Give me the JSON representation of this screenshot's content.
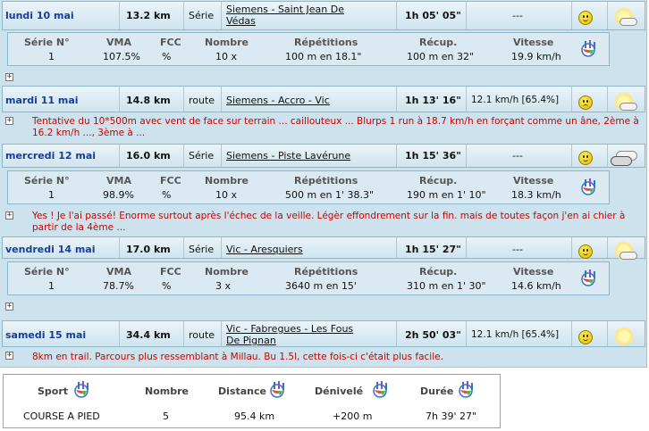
{
  "days": [
    {
      "date": "lundi 10 mai",
      "distance": "13.2 km",
      "type": "Série",
      "place": "Siemens - Saint Jean De Védas",
      "duration": "1h 05' 05\"",
      "speed": "",
      "speed_placeholder": "---",
      "mood": "happy",
      "weather": "sun-cloud",
      "comment": "",
      "detail": {
        "headers": [
          "Série N°",
          "VMA",
          "FCC",
          "Nombre",
          "Répétitions",
          "Récup.",
          "Vitesse"
        ],
        "values": [
          "1",
          "107.5%",
          "%",
          "10 x",
          "100 m en 18.1\"",
          "100 m en 32\"",
          "19.9 km/h"
        ]
      }
    },
    {
      "date": "mardi 11 mai",
      "distance": "14.8 km",
      "type": "route",
      "place": "Siemens - Accro - Vic",
      "duration": "1h 13' 16\"",
      "speed": "12.1 km/h [65.4%]",
      "speed_placeholder": "",
      "mood": "sad",
      "weather": "sun-cloud",
      "comment": "Tentative du 10*500m avec vent de face sur terrain ... caillouteux ... Blurps 1 run à 18.7 km/h en forçant comme un âne, 2ème à 16.2 km/h ..., 3ème à ...",
      "detail": null
    },
    {
      "date": "mercredi 12 mai",
      "distance": "16.0 km",
      "type": "Série",
      "place": "Siemens - Piste Lavérune",
      "duration": "1h 15' 36\"",
      "speed": "",
      "speed_placeholder": "---",
      "mood": "happy",
      "weather": "clouds",
      "comment": "Yes ! Je l'ai passé! Enorme surtout après l'échec de la veille. Légèr effondrement sur la fin. mais de toutes façon j'en ai chier à partir de la 4ème ...",
      "detail": {
        "headers": [
          "Série N°",
          "VMA",
          "FCC",
          "Nombre",
          "Répétitions",
          "Récup.",
          "Vitesse"
        ],
        "values": [
          "1",
          "98.9%",
          "%",
          "10 x",
          "500 m en 1' 38.3\"",
          "190 m en 1' 10\"",
          "18.3 km/h"
        ]
      }
    },
    {
      "date": "vendredi 14 mai",
      "distance": "17.0 km",
      "type": "Série",
      "place": "Vic - Aresquiers",
      "duration": "1h 15' 27\"",
      "speed": "",
      "speed_placeholder": "---",
      "mood": "happy",
      "weather": "sun-cloud",
      "comment": "",
      "detail": {
        "headers": [
          "Série N°",
          "VMA",
          "FCC",
          "Nombre",
          "Répétitions",
          "Récup.",
          "Vitesse"
        ],
        "values": [
          "1",
          "78.7%",
          "%",
          "3 x",
          "3640 m en 15'",
          "310 m en 1' 30\"",
          "14.6 km/h"
        ]
      }
    },
    {
      "date": "samedi 15 mai",
      "distance": "34.4 km",
      "type": "route",
      "place": "Vic - Fabregues - Les Fous De Pignan",
      "duration": "2h 50' 03\"",
      "speed": "12.1 km/h [65.4%]",
      "speed_placeholder": "",
      "mood": "happy",
      "weather": "sun",
      "comment": "8km en trail. Parcours plus ressemblant à Millau. Bu 1.5l, cette fois-ci c'était plus facile.",
      "detail": null
    }
  ],
  "summary": {
    "headers": [
      "Sport",
      "Nombre",
      "Distance",
      "Dénivelé",
      "Durée"
    ],
    "values": [
      "COURSE A PIED",
      "5",
      "95.4 km",
      "+200 m",
      "7h 39' 27\""
    ]
  }
}
